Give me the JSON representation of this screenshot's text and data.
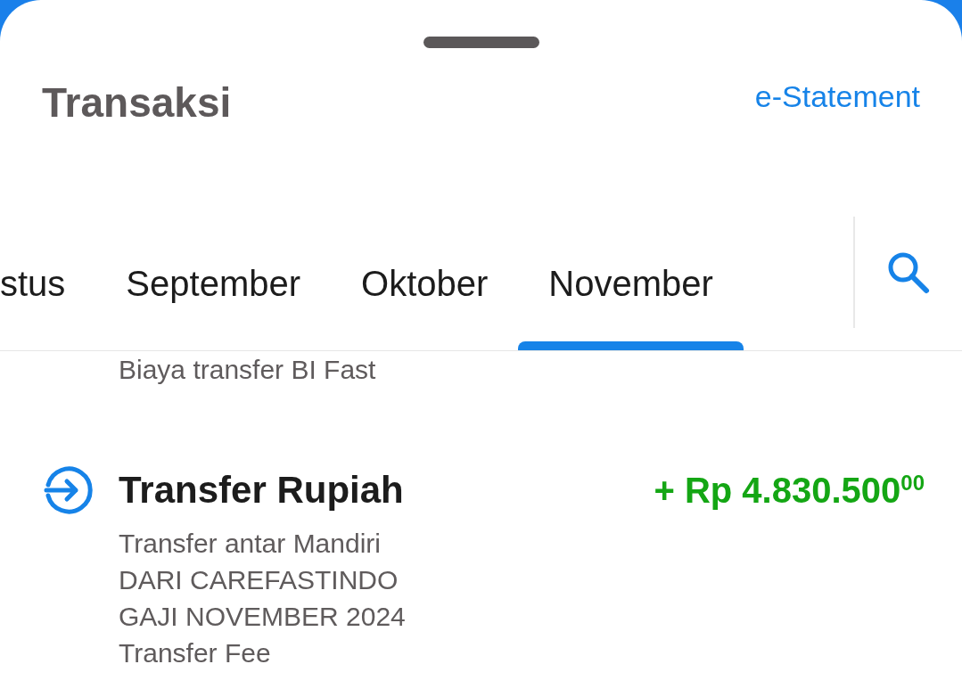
{
  "header": {
    "title": "Transaksi",
    "link": "e-Statement"
  },
  "month_tabs": [
    {
      "label": "stus",
      "selected": false
    },
    {
      "label": "September",
      "selected": false
    },
    {
      "label": "Oktober",
      "selected": false
    },
    {
      "label": "November",
      "selected": true
    }
  ],
  "transactions": [
    {
      "details": [
        "Biaya transfer BI Fast"
      ]
    },
    {
      "kind": "incoming",
      "title": "Transfer Rupiah",
      "amount": "+ Rp 4.830.500$^{00}$",
      "details": [
        "Transfer antar Mandiri",
        "DARI CAREFASTINDO",
        "GAJI NOVEMBER 2024",
        "Transfer Fee"
      ]
    }
  ]
}
